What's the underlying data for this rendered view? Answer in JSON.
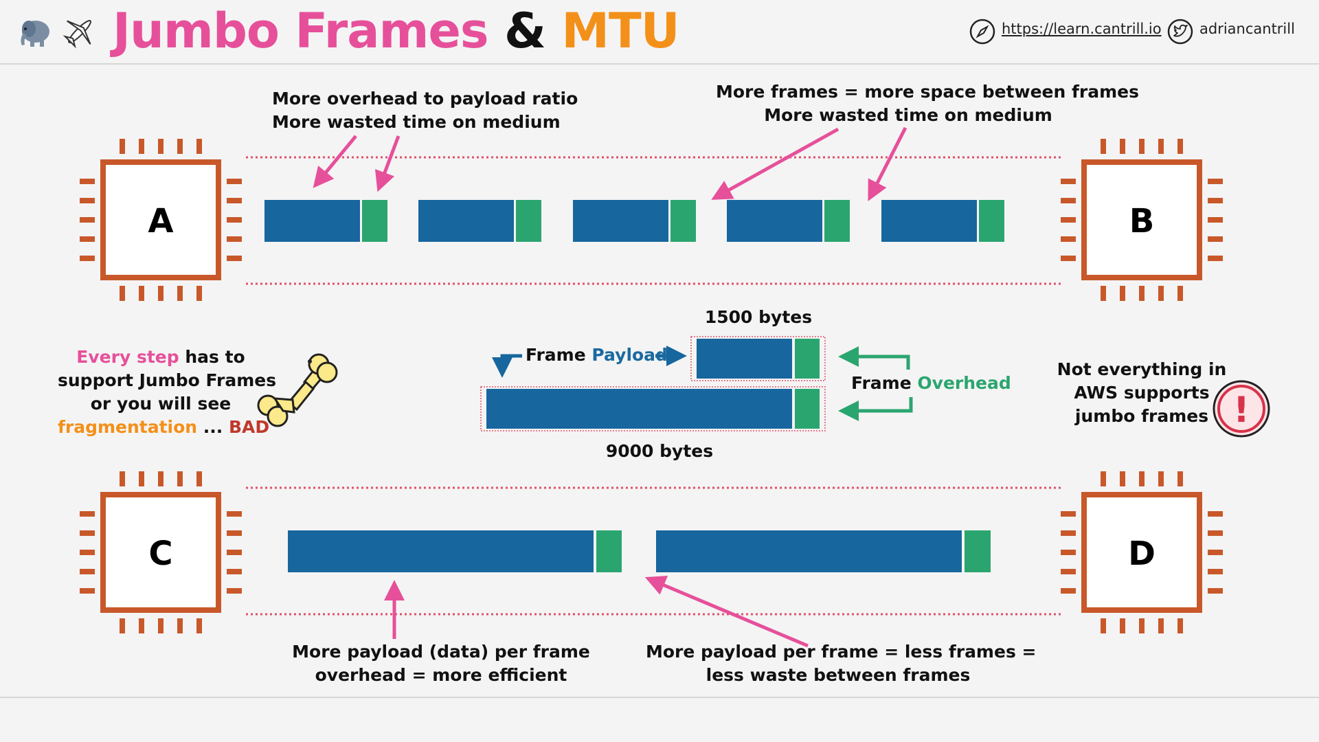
{
  "header": {
    "title_part1": "Jumbo Frames",
    "title_amp": "&",
    "title_part2": "MTU",
    "website": "https://learn.cantrill.io",
    "twitter": "adriancantrill",
    "icons": [
      "elephant-icon",
      "airplane-icon",
      "compass-icon",
      "twitter-icon"
    ]
  },
  "nodes": {
    "a": "A",
    "b": "B",
    "c": "C",
    "d": "D"
  },
  "top_section": {
    "annotation_left_line1": "More overhead to payload ratio",
    "annotation_left_line2": "More wasted time on medium",
    "annotation_right_line1": "More frames = more space between frames",
    "annotation_right_line2": "More wasted time on medium",
    "frame_count": 5
  },
  "middle_section": {
    "step_every_step": "Every step",
    "step_has_to": " has to",
    "step_line2": "support Jumbo Frames",
    "step_line3": "or you will see",
    "step_fragmentation": "fragmentation",
    "step_dots": " ... ",
    "step_bad": "BAD",
    "small_frame_label": "1500 bytes",
    "large_frame_label": "9000 bytes",
    "frame_word": "Frame ",
    "payload_word": "Payload",
    "overhead_word": "Overhead",
    "aws_line1": "Not everything in",
    "aws_line2": "AWS supports",
    "aws_line3": "jumbo frames",
    "warning_glyph": "!"
  },
  "bottom_section": {
    "annotation_left_line1": "More payload (data) per frame",
    "annotation_left_line2": "overhead = more efficient",
    "annotation_right_line1": "More payload per frame = less frames =",
    "annotation_right_line2": "less waste between frames",
    "frame_count": 2
  },
  "colors": {
    "payload": "#17669e",
    "overhead": "#2ba56f",
    "chip": "#c8582a",
    "arrow": "#e6509a",
    "medium": "#e0506a",
    "warning": "#d6334a",
    "bone": "#fbe98a"
  }
}
